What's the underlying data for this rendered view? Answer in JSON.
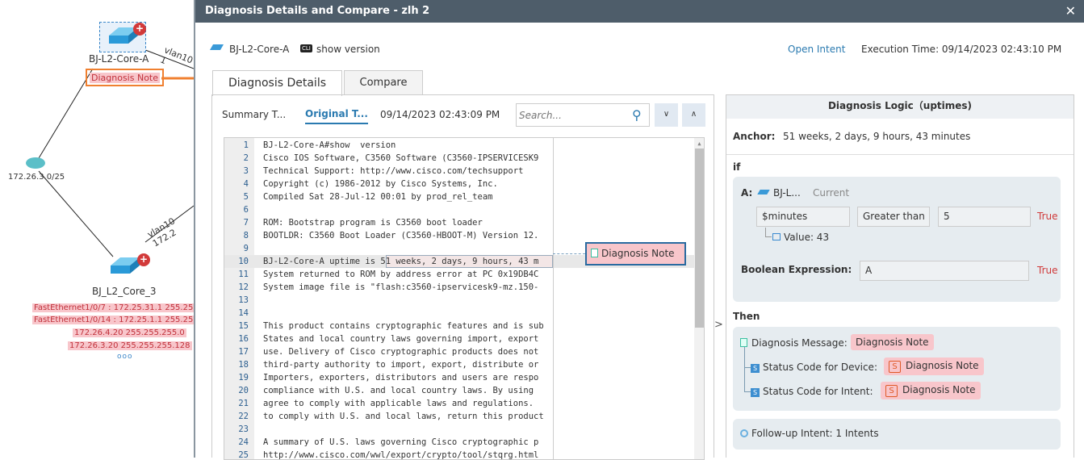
{
  "topology": {
    "device_a": "BJ-L2-Core-A",
    "device_a_note": "Diagnosis Note",
    "link_a": "vlan10 1",
    "subnet": "172.26.3.0/25",
    "link_b": "vlan10 172.2",
    "device_b": "BJ_L2_Core_3",
    "device_b_notes": [
      "FastEthernet1/0/7 : 172.25.31.1 255.255",
      "FastEthernet1/0/14 : 172.25.1.1 255.255",
      "172.26.4.20 255.255.255.0",
      "172.26.3.20 255.255.255.128"
    ],
    "more": "ooo"
  },
  "modal": {
    "title": "Diagnosis Details and Compare - zlh 2",
    "close": "✕",
    "device": "BJ-L2-Core-A",
    "cli_badge": "CLI",
    "command": "show version",
    "open_intent": "Open Intent",
    "execution_time": "Execution Time: 09/14/2023 02:43:10 PM",
    "tabs": [
      "Diagnosis Details",
      "Compare"
    ],
    "subtabs": [
      "Summary T...",
      "Original T..."
    ],
    "timestamp": "09/14/2023 02:43:09 PM",
    "search_placeholder": "Search...",
    "code_lines": [
      "BJ-L2-Core-A#show  version",
      "Cisco IOS Software, C3560 Software (C3560-IPSERVICESK9",
      "Technical Support: http://www.cisco.com/techsupport",
      "Copyright (c) 1986-2012 by Cisco Systems, Inc.",
      "Compiled Sat 28-Jul-12 00:01 by prod_rel_team",
      "",
      "ROM: Bootstrap program is C3560 boot loader",
      "BOOTLDR: C3560 Boot Loader (C3560-HBOOT-M) Version 12.",
      "",
      "BJ-L2-Core-A uptime is 51 weeks, 2 days, 9 hours, 43 m",
      "System returned to ROM by address error at PC 0x19DB4C",
      "System image file is \"flash:c3560-ipservicesk9-mz.150-",
      "",
      "",
      "This product contains cryptographic features and is sub",
      "States and local country laws governing import, export",
      "use. Delivery of Cisco cryptographic products does not",
      "third-party authority to import, export, distribute or",
      "Importers, exporters, distributors and users are respo",
      "compliance with U.S. and local country laws. By using",
      "agree to comply with applicable laws and regulations.",
      "to comply with U.S. and local laws, return this product",
      "",
      "A summary of U.S. laws governing Cisco cryptographic p",
      "http://www.cisco.com/wwl/export/crypto/tool/stqrg.html"
    ],
    "highlight_line": 10,
    "callout": "Diagnosis Note",
    "logic": {
      "title": "Diagnosis Logic（uptimes)",
      "anchor_label": "Anchor:",
      "anchor_value": "51 weeks, 2 days, 9 hours, 43 minutes",
      "if_label": "if",
      "a_label": "A:",
      "a_device": "BJ-L...",
      "a_current": "Current",
      "variable": "$minutes",
      "operator": "Greater than",
      "operand": "5",
      "result": "True",
      "value_label": "Value: 43",
      "bool_label": "Boolean Expression:",
      "bool_value": "A",
      "bool_result": "True",
      "then_label": "Then",
      "msg_label": "Diagnosis Message:",
      "msg_value": "Diagnosis Note",
      "dev_label": "Status Code for Device:",
      "dev_value": "Diagnosis Note",
      "intent_label": "Status Code for Intent:",
      "intent_value": "Diagnosis Note",
      "s_badge": "S",
      "followup": "Follow-up Intent: 1 Intents"
    }
  },
  "colors": {
    "accent": "#2a7ab0",
    "orange": "#f08030",
    "true": "#d03a3a",
    "note_bg": "#f8c6cb"
  }
}
